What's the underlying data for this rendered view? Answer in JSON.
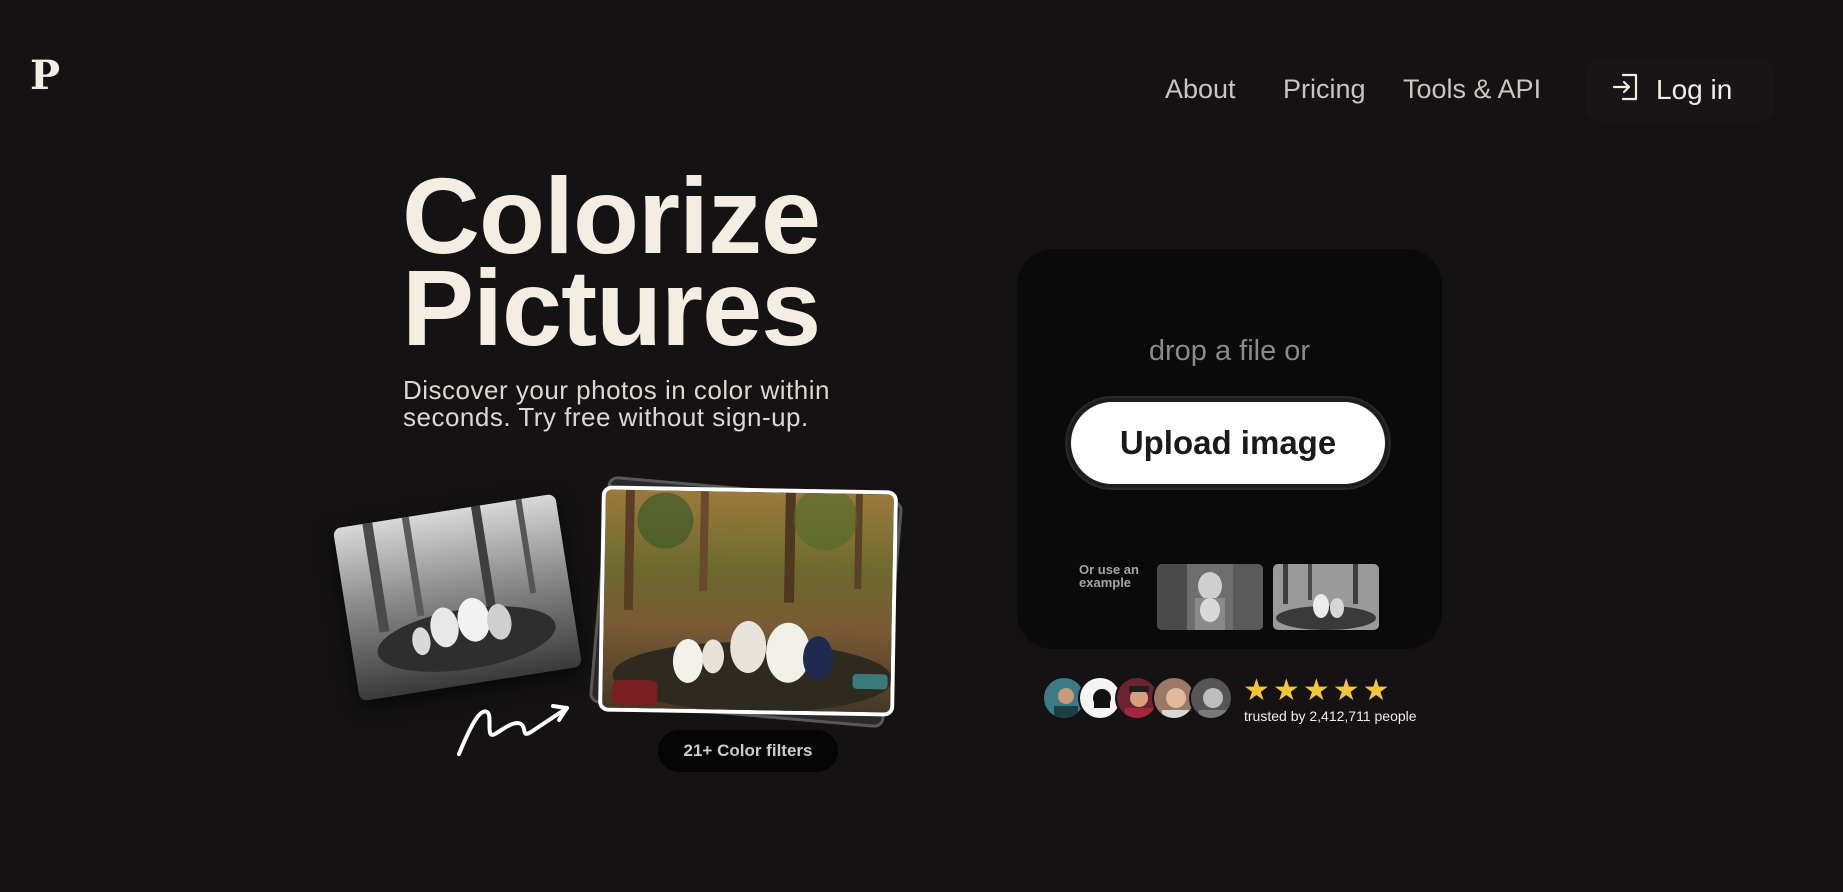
{
  "brand": {
    "logo": "P"
  },
  "nav": {
    "about": "About",
    "pricing": "Pricing",
    "tools": "Tools & API",
    "login": "Log in"
  },
  "hero": {
    "title_line1": "Colorize",
    "title_line2": "Pictures",
    "subtitle": "Discover your photos in color within seconds. Try free without sign-up.",
    "filters_badge": "21+ Color filters"
  },
  "upload": {
    "drop_text": "drop a file or",
    "button": "Upload image",
    "example_label": "Or use an example"
  },
  "trust": {
    "stars": "★★★★★",
    "text": "trusted by 2,412,711 people"
  },
  "colors": {
    "background": "#141213",
    "text": "#f3ede2",
    "star": "#f4c43a",
    "card": "#0a0a0a"
  }
}
